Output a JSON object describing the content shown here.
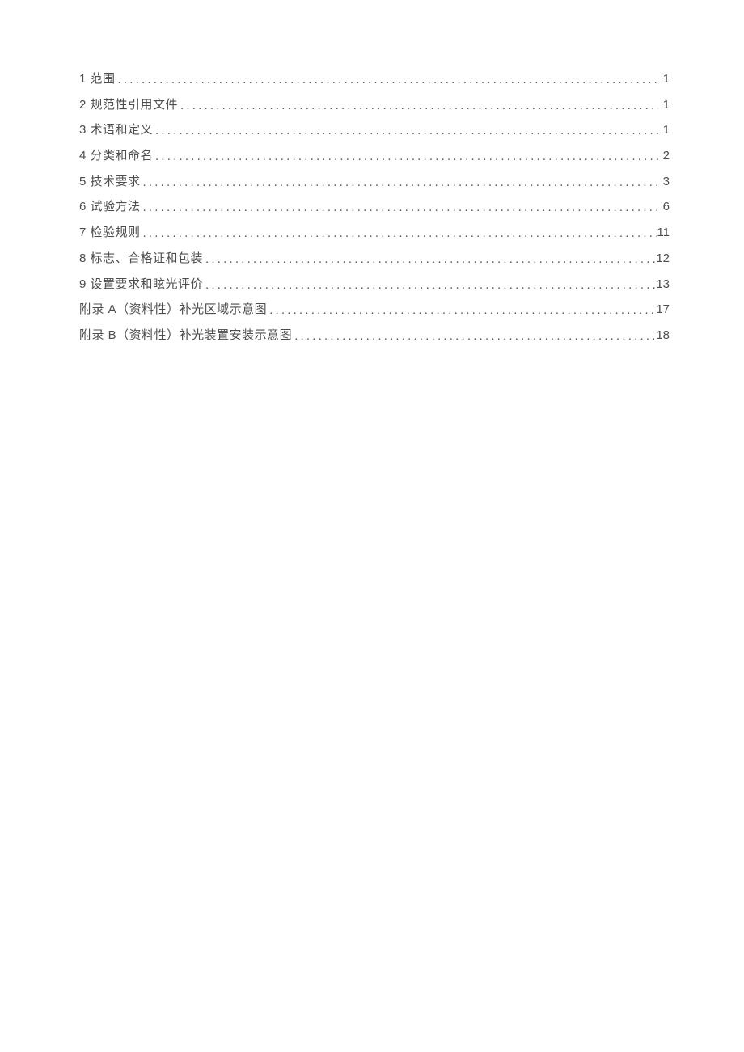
{
  "toc": [
    {
      "title": "1 范围",
      "page": "1"
    },
    {
      "title": "2 规范性引用文件",
      "page": "1"
    },
    {
      "title": "3 术语和定义",
      "page": "1"
    },
    {
      "title": "4 分类和命名",
      "page": "2"
    },
    {
      "title": "5 技术要求",
      "page": "3"
    },
    {
      "title": "6 试验方法",
      "page": "6"
    },
    {
      "title": "7 检验规则",
      "page": "11"
    },
    {
      "title": "8 标志、合格证和包装",
      "page": "12"
    },
    {
      "title": "9 设置要求和眩光评价",
      "page": "13"
    },
    {
      "title": "附录 A（资料性）补光区域示意图",
      "page": "17"
    },
    {
      "title": "附录 B（资料性）补光装置安装示意图",
      "page": "18"
    }
  ]
}
